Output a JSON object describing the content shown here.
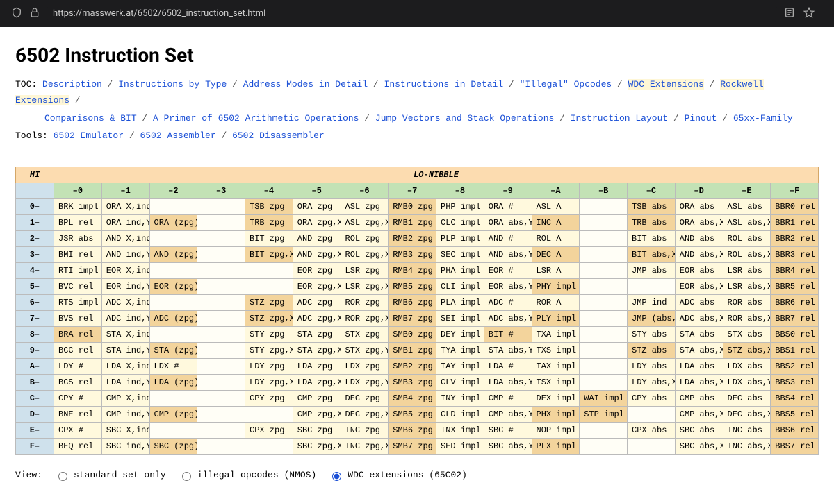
{
  "browser": {
    "url": "https://masswerk.at/6502/6502_instruction_set.html"
  },
  "title": "6502 Instruction Set",
  "toc_label": "TOC:",
  "toc": [
    {
      "label": "Description",
      "hl": false
    },
    {
      "label": "Instructions by Type",
      "hl": false
    },
    {
      "label": "Address Modes in Detail",
      "hl": false
    },
    {
      "label": "Instructions in Detail",
      "hl": false
    },
    {
      "label": "\"Illegal\" Opcodes",
      "hl": false
    },
    {
      "label": "WDC Extensions",
      "hl": true
    },
    {
      "label": "Rockwell Extensions",
      "hl": true
    },
    {
      "label": "Comparisons & BIT",
      "hl": false
    },
    {
      "label": "A Primer of 6502 Arithmetic Operations",
      "hl": false
    },
    {
      "label": "Jump Vectors and Stack Operations",
      "hl": false
    },
    {
      "label": "Instruction Layout",
      "hl": false
    },
    {
      "label": "Pinout",
      "hl": false
    },
    {
      "label": "65xx-Family",
      "hl": false
    }
  ],
  "toc_break_after": 6,
  "tools_label": "Tools:",
  "tools": [
    {
      "label": "6502 Emulator"
    },
    {
      "label": "6502 Assembler"
    },
    {
      "label": "6502 Disassembler"
    }
  ],
  "table": {
    "hi_label": "HI",
    "lo_label": "LO-NIBBLE",
    "cols": [
      "–0",
      "–1",
      "–2",
      "–3",
      "–4",
      "–5",
      "–6",
      "–7",
      "–8",
      "–9",
      "–A",
      "–B",
      "–C",
      "–D",
      "–E",
      "–F"
    ],
    "rows": [
      {
        "h": "0–",
        "c": [
          [
            "BRK impl",
            "std"
          ],
          [
            "ORA X,ind",
            "std"
          ],
          [
            "",
            ""
          ],
          [
            "",
            ""
          ],
          [
            "TSB zpg",
            "ext"
          ],
          [
            "ORA zpg",
            "std"
          ],
          [
            "ASL zpg",
            "std"
          ],
          [
            "RMB0 zpg",
            "ext"
          ],
          [
            "PHP impl",
            "std"
          ],
          [
            "ORA #",
            "std"
          ],
          [
            "ASL A",
            "std"
          ],
          [
            "",
            ""
          ],
          [
            "TSB abs",
            "ext"
          ],
          [
            "ORA abs",
            "std"
          ],
          [
            "ASL abs",
            "std"
          ],
          [
            "BBR0 rel",
            "ext"
          ]
        ]
      },
      {
        "h": "1–",
        "c": [
          [
            "BPL rel",
            "std"
          ],
          [
            "ORA ind,Y",
            "std"
          ],
          [
            "ORA (zpg)",
            "ext"
          ],
          [
            "",
            ""
          ],
          [
            "TRB zpg",
            "ext"
          ],
          [
            "ORA zpg,X",
            "std"
          ],
          [
            "ASL zpg,X",
            "std"
          ],
          [
            "RMB1 zpg",
            "ext"
          ],
          [
            "CLC impl",
            "std"
          ],
          [
            "ORA abs,Y",
            "std"
          ],
          [
            "INC A",
            "ext"
          ],
          [
            "",
            ""
          ],
          [
            "TRB abs",
            "ext"
          ],
          [
            "ORA abs,X",
            "std"
          ],
          [
            "ASL abs,X",
            "std"
          ],
          [
            "BBR1 rel",
            "ext"
          ]
        ]
      },
      {
        "h": "2–",
        "c": [
          [
            "JSR abs",
            "std"
          ],
          [
            "AND X,ind",
            "std"
          ],
          [
            "",
            ""
          ],
          [
            "",
            ""
          ],
          [
            "BIT zpg",
            "std"
          ],
          [
            "AND zpg",
            "std"
          ],
          [
            "ROL zpg",
            "std"
          ],
          [
            "RMB2 zpg",
            "ext"
          ],
          [
            "PLP impl",
            "std"
          ],
          [
            "AND #",
            "std"
          ],
          [
            "ROL A",
            "std"
          ],
          [
            "",
            ""
          ],
          [
            "BIT abs",
            "std"
          ],
          [
            "AND abs",
            "std"
          ],
          [
            "ROL abs",
            "std"
          ],
          [
            "BBR2 rel",
            "ext"
          ]
        ]
      },
      {
        "h": "3–",
        "c": [
          [
            "BMI rel",
            "std"
          ],
          [
            "AND ind,Y",
            "std"
          ],
          [
            "AND (zpg)",
            "ext"
          ],
          [
            "",
            ""
          ],
          [
            "BIT zpg,X",
            "ext"
          ],
          [
            "AND zpg,X",
            "std"
          ],
          [
            "ROL zpg,X",
            "std"
          ],
          [
            "RMB3 zpg",
            "ext"
          ],
          [
            "SEC impl",
            "std"
          ],
          [
            "AND abs,Y",
            "std"
          ],
          [
            "DEC A",
            "ext"
          ],
          [
            "",
            ""
          ],
          [
            "BIT abs,X",
            "ext"
          ],
          [
            "AND abs,X",
            "std"
          ],
          [
            "ROL abs,X",
            "std"
          ],
          [
            "BBR3 rel",
            "ext"
          ]
        ]
      },
      {
        "h": "4–",
        "c": [
          [
            "RTI impl",
            "std"
          ],
          [
            "EOR X,ind",
            "std"
          ],
          [
            "",
            ""
          ],
          [
            "",
            ""
          ],
          [
            "",
            ""
          ],
          [
            "EOR zpg",
            "std"
          ],
          [
            "LSR zpg",
            "std"
          ],
          [
            "RMB4 zpg",
            "ext"
          ],
          [
            "PHA impl",
            "std"
          ],
          [
            "EOR #",
            "std"
          ],
          [
            "LSR A",
            "std"
          ],
          [
            "",
            ""
          ],
          [
            "JMP abs",
            "std"
          ],
          [
            "EOR abs",
            "std"
          ],
          [
            "LSR abs",
            "std"
          ],
          [
            "BBR4 rel",
            "ext"
          ]
        ]
      },
      {
        "h": "5–",
        "c": [
          [
            "BVC rel",
            "std"
          ],
          [
            "EOR ind,Y",
            "std"
          ],
          [
            "EOR (zpg)",
            "ext"
          ],
          [
            "",
            ""
          ],
          [
            "",
            ""
          ],
          [
            "EOR zpg,X",
            "std"
          ],
          [
            "LSR zpg,X",
            "std"
          ],
          [
            "RMB5 zpg",
            "ext"
          ],
          [
            "CLI impl",
            "std"
          ],
          [
            "EOR abs,Y",
            "std"
          ],
          [
            "PHY impl",
            "ext"
          ],
          [
            "",
            ""
          ],
          [
            "",
            ""
          ],
          [
            "EOR abs,X",
            "std"
          ],
          [
            "LSR abs,X",
            "std"
          ],
          [
            "BBR5 rel",
            "ext"
          ]
        ]
      },
      {
        "h": "6–",
        "c": [
          [
            "RTS impl",
            "std"
          ],
          [
            "ADC X,ind",
            "std"
          ],
          [
            "",
            ""
          ],
          [
            "",
            ""
          ],
          [
            "STZ zpg",
            "ext"
          ],
          [
            "ADC zpg",
            "std"
          ],
          [
            "ROR zpg",
            "std"
          ],
          [
            "RMB6 zpg",
            "ext"
          ],
          [
            "PLA impl",
            "std"
          ],
          [
            "ADC #",
            "std"
          ],
          [
            "ROR A",
            "std"
          ],
          [
            "",
            ""
          ],
          [
            "JMP ind",
            "std"
          ],
          [
            "ADC abs",
            "std"
          ],
          [
            "ROR abs",
            "std"
          ],
          [
            "BBR6 rel",
            "ext"
          ]
        ]
      },
      {
        "h": "7–",
        "c": [
          [
            "BVS rel",
            "std"
          ],
          [
            "ADC ind,Y",
            "std"
          ],
          [
            "ADC (zpg)",
            "ext"
          ],
          [
            "",
            ""
          ],
          [
            "STZ zpg,X",
            "ext"
          ],
          [
            "ADC zpg,X",
            "std"
          ],
          [
            "ROR zpg,X",
            "std"
          ],
          [
            "RMB7 zpg",
            "ext"
          ],
          [
            "SEI impl",
            "std"
          ],
          [
            "ADC abs,Y",
            "std"
          ],
          [
            "PLY impl",
            "ext"
          ],
          [
            "",
            ""
          ],
          [
            "JMP (abs,X)",
            "ext"
          ],
          [
            "ADC abs,X",
            "std"
          ],
          [
            "ROR abs,X",
            "std"
          ],
          [
            "BBR7 rel",
            "ext"
          ]
        ]
      },
      {
        "h": "8–",
        "c": [
          [
            "BRA rel",
            "ext"
          ],
          [
            "STA X,ind",
            "std"
          ],
          [
            "",
            ""
          ],
          [
            "",
            ""
          ],
          [
            "STY zpg",
            "std"
          ],
          [
            "STA zpg",
            "std"
          ],
          [
            "STX zpg",
            "std"
          ],
          [
            "SMB0 zpg",
            "ext"
          ],
          [
            "DEY impl",
            "std"
          ],
          [
            "BIT #",
            "ext"
          ],
          [
            "TXA impl",
            "std"
          ],
          [
            "",
            ""
          ],
          [
            "STY abs",
            "std"
          ],
          [
            "STA abs",
            "std"
          ],
          [
            "STX abs",
            "std"
          ],
          [
            "BBS0 rel",
            "ext"
          ]
        ]
      },
      {
        "h": "9–",
        "c": [
          [
            "BCC rel",
            "std"
          ],
          [
            "STA ind,Y",
            "std"
          ],
          [
            "STA (zpg)",
            "ext"
          ],
          [
            "",
            ""
          ],
          [
            "STY zpg,X",
            "std"
          ],
          [
            "STA zpg,X",
            "std"
          ],
          [
            "STX zpg,Y",
            "std"
          ],
          [
            "SMB1 zpg",
            "ext"
          ],
          [
            "TYA impl",
            "std"
          ],
          [
            "STA abs,Y",
            "std"
          ],
          [
            "TXS impl",
            "std"
          ],
          [
            "",
            ""
          ],
          [
            "STZ abs",
            "ext"
          ],
          [
            "STA abs,X",
            "std"
          ],
          [
            "STZ abs,X",
            "ext"
          ],
          [
            "BBS1 rel",
            "ext"
          ]
        ]
      },
      {
        "h": "A–",
        "c": [
          [
            "LDY #",
            "std"
          ],
          [
            "LDA X,ind",
            "std"
          ],
          [
            "LDX #",
            "std"
          ],
          [
            "",
            ""
          ],
          [
            "LDY zpg",
            "std"
          ],
          [
            "LDA zpg",
            "std"
          ],
          [
            "LDX zpg",
            "std"
          ],
          [
            "SMB2 zpg",
            "ext"
          ],
          [
            "TAY impl",
            "std"
          ],
          [
            "LDA #",
            "std"
          ],
          [
            "TAX impl",
            "std"
          ],
          [
            "",
            ""
          ],
          [
            "LDY abs",
            "std"
          ],
          [
            "LDA abs",
            "std"
          ],
          [
            "LDX abs",
            "std"
          ],
          [
            "BBS2 rel",
            "ext"
          ]
        ]
      },
      {
        "h": "B–",
        "c": [
          [
            "BCS rel",
            "std"
          ],
          [
            "LDA ind,Y",
            "std"
          ],
          [
            "LDA (zpg)",
            "ext"
          ],
          [
            "",
            ""
          ],
          [
            "LDY zpg,X",
            "std"
          ],
          [
            "LDA zpg,X",
            "std"
          ],
          [
            "LDX zpg,Y",
            "std"
          ],
          [
            "SMB3 zpg",
            "ext"
          ],
          [
            "CLV impl",
            "std"
          ],
          [
            "LDA abs,Y",
            "std"
          ],
          [
            "TSX impl",
            "std"
          ],
          [
            "",
            ""
          ],
          [
            "LDY abs,X",
            "std"
          ],
          [
            "LDA abs,X",
            "std"
          ],
          [
            "LDX abs,Y",
            "std"
          ],
          [
            "BBS3 rel",
            "ext"
          ]
        ]
      },
      {
        "h": "C–",
        "c": [
          [
            "CPY #",
            "std"
          ],
          [
            "CMP X,ind",
            "std"
          ],
          [
            "",
            ""
          ],
          [
            "",
            ""
          ],
          [
            "CPY zpg",
            "std"
          ],
          [
            "CMP zpg",
            "std"
          ],
          [
            "DEC zpg",
            "std"
          ],
          [
            "SMB4 zpg",
            "ext"
          ],
          [
            "INY impl",
            "std"
          ],
          [
            "CMP #",
            "std"
          ],
          [
            "DEX impl",
            "std"
          ],
          [
            "WAI impl",
            "ext"
          ],
          [
            "CPY abs",
            "std"
          ],
          [
            "CMP abs",
            "std"
          ],
          [
            "DEC abs",
            "std"
          ],
          [
            "BBS4 rel",
            "ext"
          ]
        ]
      },
      {
        "h": "D–",
        "c": [
          [
            "BNE rel",
            "std"
          ],
          [
            "CMP ind,Y",
            "std"
          ],
          [
            "CMP (zpg)",
            "ext"
          ],
          [
            "",
            ""
          ],
          [
            "",
            ""
          ],
          [
            "CMP zpg,X",
            "std"
          ],
          [
            "DEC zpg,X",
            "std"
          ],
          [
            "SMB5 zpg",
            "ext"
          ],
          [
            "CLD impl",
            "std"
          ],
          [
            "CMP abs,Y",
            "std"
          ],
          [
            "PHX impl",
            "ext"
          ],
          [
            "STP impl",
            "ext"
          ],
          [
            "",
            ""
          ],
          [
            "CMP abs,X",
            "std"
          ],
          [
            "DEC abs,X",
            "std"
          ],
          [
            "BBS5 rel",
            "ext"
          ]
        ]
      },
      {
        "h": "E–",
        "c": [
          [
            "CPX #",
            "std"
          ],
          [
            "SBC X,ind",
            "std"
          ],
          [
            "",
            ""
          ],
          [
            "",
            ""
          ],
          [
            "CPX zpg",
            "std"
          ],
          [
            "SBC zpg",
            "std"
          ],
          [
            "INC zpg",
            "std"
          ],
          [
            "SMB6 zpg",
            "ext"
          ],
          [
            "INX impl",
            "std"
          ],
          [
            "SBC #",
            "std"
          ],
          [
            "NOP impl",
            "std"
          ],
          [
            "",
            ""
          ],
          [
            "CPX abs",
            "std"
          ],
          [
            "SBC abs",
            "std"
          ],
          [
            "INC abs",
            "std"
          ],
          [
            "BBS6 rel",
            "ext"
          ]
        ]
      },
      {
        "h": "F–",
        "c": [
          [
            "BEQ rel",
            "std"
          ],
          [
            "SBC ind,Y",
            "std"
          ],
          [
            "SBC (zpg)",
            "ext"
          ],
          [
            "",
            ""
          ],
          [
            "",
            ""
          ],
          [
            "SBC zpg,X",
            "std"
          ],
          [
            "INC zpg,X",
            "std"
          ],
          [
            "SMB7 zpg",
            "ext"
          ],
          [
            "SED impl",
            "std"
          ],
          [
            "SBC abs,Y",
            "std"
          ],
          [
            "PLX impl",
            "ext"
          ],
          [
            "",
            ""
          ],
          [
            "",
            ""
          ],
          [
            "SBC abs,X",
            "std"
          ],
          [
            "INC abs,X",
            "std"
          ],
          [
            "BBS7 rel",
            "ext"
          ]
        ]
      }
    ]
  },
  "view": {
    "label": "View:",
    "options": [
      {
        "label": "standard set only",
        "value": "std",
        "checked": false
      },
      {
        "label": "illegal opcodes (NMOS)",
        "value": "ill",
        "checked": false
      },
      {
        "label": "WDC extensions (65C02)",
        "value": "wdc",
        "checked": true
      }
    ]
  }
}
